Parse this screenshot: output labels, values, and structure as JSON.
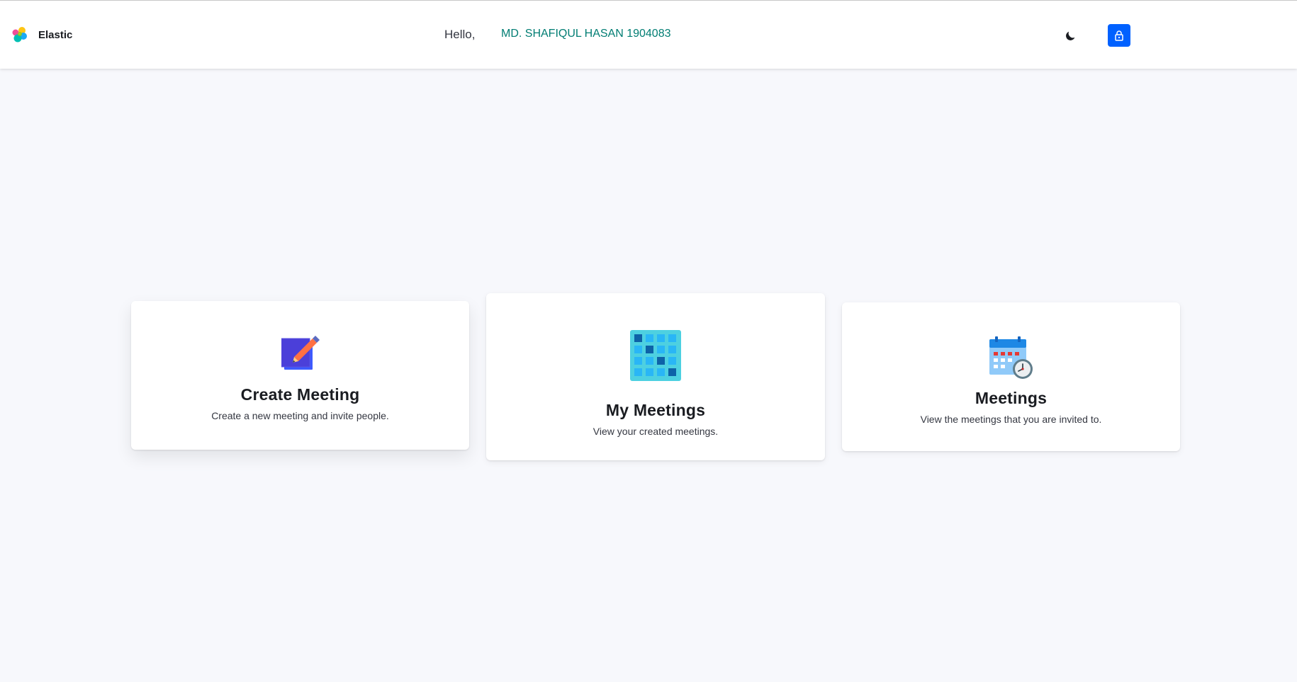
{
  "header": {
    "brand_name": "Elastic",
    "greeting": "Hello,",
    "user_name": "MD. SHAFIQUL HASAN 1904083",
    "theme_toggle_icon": "moon-icon",
    "lock_button_icon": "lock-icon",
    "lock_button_color": "#0061ff"
  },
  "cards": [
    {
      "title": "Create Meeting",
      "description": "Create a new meeting and invite people.",
      "icon": "edit-note-icon"
    },
    {
      "title": "My Meetings",
      "description": "View your created meetings.",
      "icon": "calendar-grid-icon"
    },
    {
      "title": "Meetings",
      "description": "View the meetings that you are invited to.",
      "icon": "calendar-clock-icon"
    }
  ],
  "colors": {
    "accent": "#0061ff",
    "user_name": "#017d73",
    "page_background": "#f7f8fc"
  }
}
